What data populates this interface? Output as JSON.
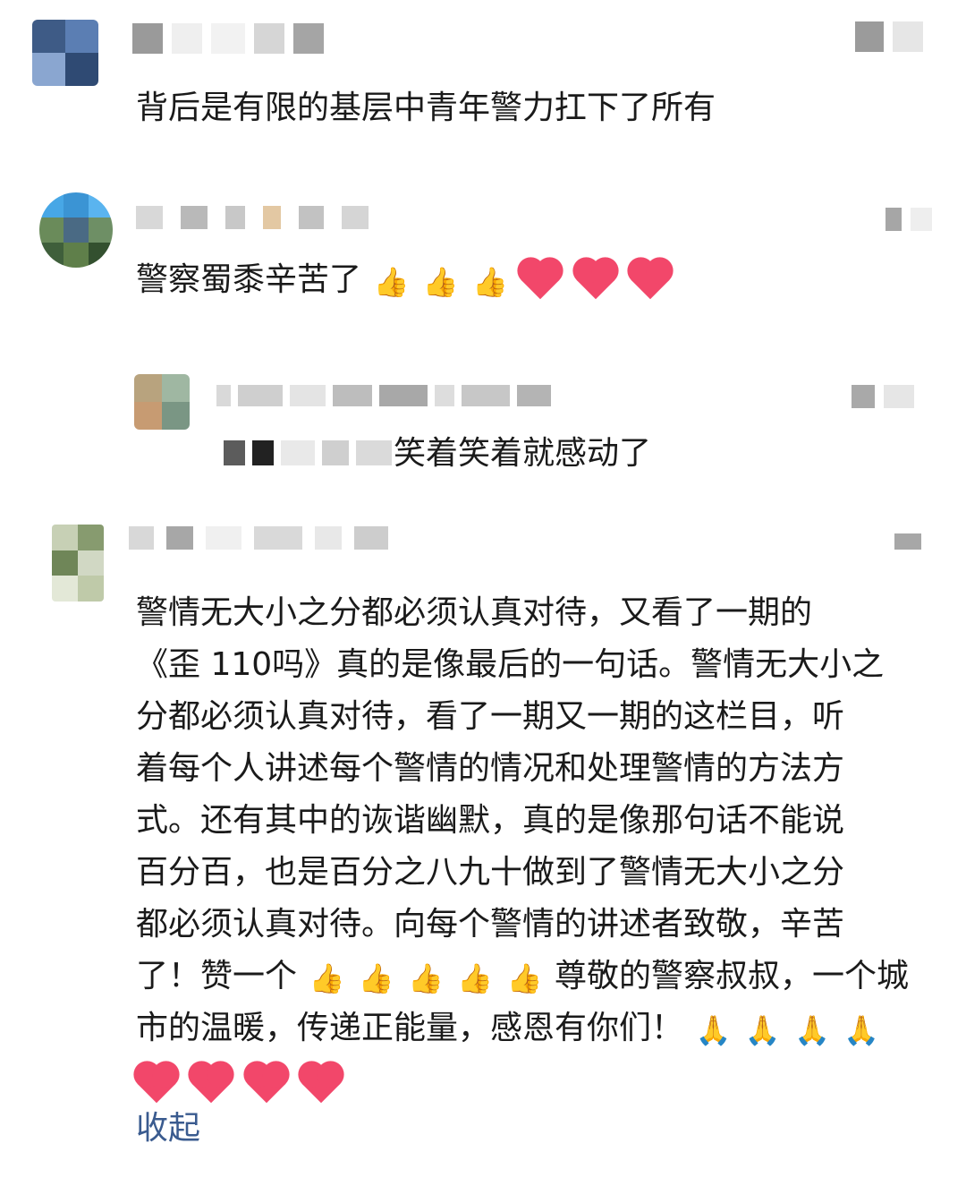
{
  "comments": [
    {
      "text": "背后是有限的基层中青年警力扛下了所有"
    },
    {
      "text": "警察蜀黍辛苦了",
      "emojis": [
        "thumbs-up",
        "thumbs-up",
        "thumbs-up",
        "heart",
        "heart",
        "heart"
      ]
    },
    {
      "reply_text": "笑着笑着就感动了"
    },
    {
      "lines": [
        "警情无大小之分都必须认真对待，又看了一期的",
        "《歪 110吗》真的是像最后的一句话。警情无大小之",
        "分都必须认真对待，看了一期又一期的这栏目，听",
        "着每个人讲述每个警情的情况和处理警情的方法方",
        "式。还有其中的诙谐幽默，真的是像那句话不能说",
        "百分百，也是百分之八九十做到了警情无大小之分",
        "都必须认真对待。向每个警情的讲述者致敬，辛苦",
        "了！赞一个",
        "尊敬的警察叔叔，一个城",
        "市的温暖，传递正能量，感恩有你们！"
      ],
      "collapse_label": "收起"
    }
  ],
  "icons": {
    "thumb": "👍",
    "pray": "🙏"
  },
  "colors": {
    "link": "#3a5b8f",
    "heart": "#f2476a"
  }
}
